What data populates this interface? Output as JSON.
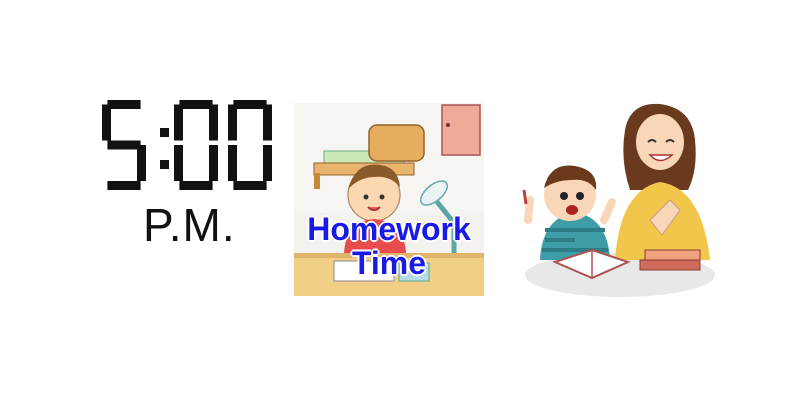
{
  "clock": {
    "time": "5:00",
    "period": "P.M."
  },
  "homework": {
    "line1": "Homework",
    "line2": "Time",
    "text_color": "#1a1ae6"
  },
  "illustrations": {
    "left": "boy-doing-homework-illustration",
    "right": "mother-and-son-studying-illustration"
  }
}
